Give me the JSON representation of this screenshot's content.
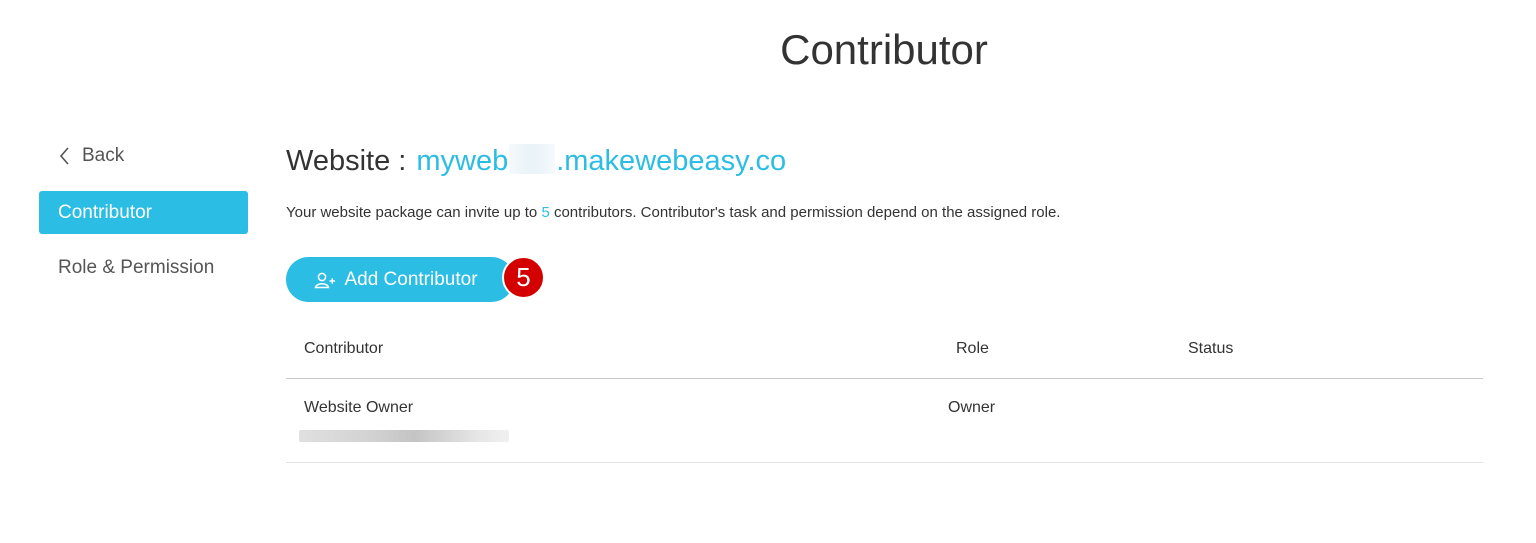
{
  "page": {
    "title": "Contributor"
  },
  "sidebar": {
    "back_label": "Back",
    "items": [
      {
        "label": "Contributor",
        "active": true
      },
      {
        "label": "Role & Permission",
        "active": false
      }
    ]
  },
  "website": {
    "prefix": "Website :",
    "name_start": "myweb",
    "name_domain": ".makewebeasy.co"
  },
  "intro": {
    "before": "Your website package can invite up to ",
    "limit": "5",
    "after": " contributors. Contributor's task and permission depend on the assigned role."
  },
  "add_button": {
    "label": "Add Contributor",
    "icon": "add-user-icon"
  },
  "step_badge": "5",
  "table": {
    "columns": [
      "Contributor",
      "Role",
      "Status"
    ],
    "rows": [
      {
        "name": "Website Owner",
        "role": "Owner",
        "status": ""
      }
    ]
  },
  "colors": {
    "accent": "#2bbde3",
    "badge": "#d40000"
  }
}
